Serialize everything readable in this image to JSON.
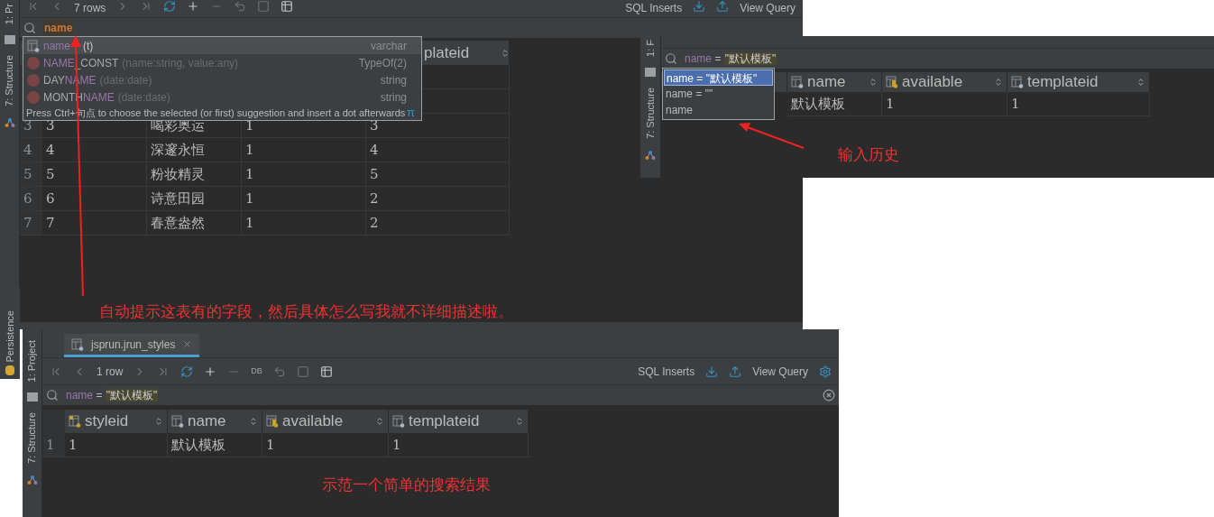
{
  "autocomplete_window": {
    "side_tabs": [
      "1: Pr",
      "7: Structure",
      "Persistence"
    ],
    "toolbar": {
      "row_count": "7 rows",
      "sql_inserts": "SQL Inserts",
      "view_query": "View Query"
    },
    "filter": {
      "value": "name"
    },
    "table": {
      "last_column_header": "plateid",
      "rows": [
        {
          "num": "3",
          "cells": [
            "3",
            "喝彩奥运",
            "1",
            "3"
          ]
        },
        {
          "num": "4",
          "cells": [
            "4",
            "深邃永恒",
            "1",
            "4"
          ]
        },
        {
          "num": "5",
          "cells": [
            "5",
            "粉妆精灵",
            "1",
            "5"
          ]
        },
        {
          "num": "6",
          "cells": [
            "6",
            "诗意田园",
            "1",
            "2"
          ]
        },
        {
          "num": "7",
          "cells": [
            "7",
            "春意盎然",
            "1",
            "2"
          ]
        }
      ]
    },
    "suggestions": [
      {
        "kind": "column",
        "match": "name",
        "params": "(t)",
        "type": "varchar",
        "selected": true
      },
      {
        "kind": "function",
        "match": "NAME",
        "rest": "_CONST",
        "params": "(name:string, value:any)",
        "type": "TypeOf(2)",
        "selected": false
      },
      {
        "kind": "function",
        "prefix": "DAY",
        "match": "NAME",
        "params": "(date:date)",
        "type": "string",
        "selected": false
      },
      {
        "kind": "function",
        "prefix": "MONTH",
        "match": "NAME",
        "params": "(date:date)",
        "type": "string",
        "selected": false
      }
    ],
    "popup_hint": "Press Ctrl+句点 to choose the selected (or first) suggestion and insert a dot afterwards",
    "popup_hint_symbol": "π",
    "annotation": "自动提示这表有的字段，然后具体怎么写我就不详细描述啦。"
  },
  "history_window": {
    "side_tabs": [
      "1: F",
      "7: Structure"
    ],
    "filter": {
      "column": "name",
      "op": "=",
      "value": "\"默认模板\""
    },
    "history": [
      {
        "text": "name = \"默认模板\"",
        "selected": true
      },
      {
        "text": "name = \"\"",
        "selected": false
      },
      {
        "text": "name",
        "selected": false
      }
    ],
    "table": {
      "columns": [
        {
          "name": "name",
          "kind": "plain"
        },
        {
          "name": "available",
          "kind": "indexed"
        },
        {
          "name": "templateid",
          "kind": "plain"
        }
      ],
      "rows": [
        {
          "cells": [
            "默认模板",
            "1",
            "1"
          ]
        }
      ]
    },
    "annotation": "输入历史"
  },
  "result_window": {
    "side_tabs": [
      "1: Project",
      "7: Structure"
    ],
    "tab": {
      "label": "jsprun.jrun_styles",
      "selected": true
    },
    "toolbar": {
      "row_count": "1 row",
      "db_label": "DB",
      "sql_inserts": "SQL Inserts",
      "view_query": "View Query"
    },
    "filter": {
      "column": "name",
      "op": "=",
      "value": "\"默认模板\""
    },
    "table": {
      "columns": [
        {
          "name": "styleid",
          "kind": "primary_key"
        },
        {
          "name": "name",
          "kind": "plain"
        },
        {
          "name": "available",
          "kind": "indexed"
        },
        {
          "name": "templateid",
          "kind": "plain"
        }
      ],
      "rows": [
        {
          "num": "1",
          "cells": [
            "1",
            "默认模板",
            "1",
            "1"
          ]
        }
      ]
    },
    "annotation": "示范一个简单的搜索结果"
  }
}
